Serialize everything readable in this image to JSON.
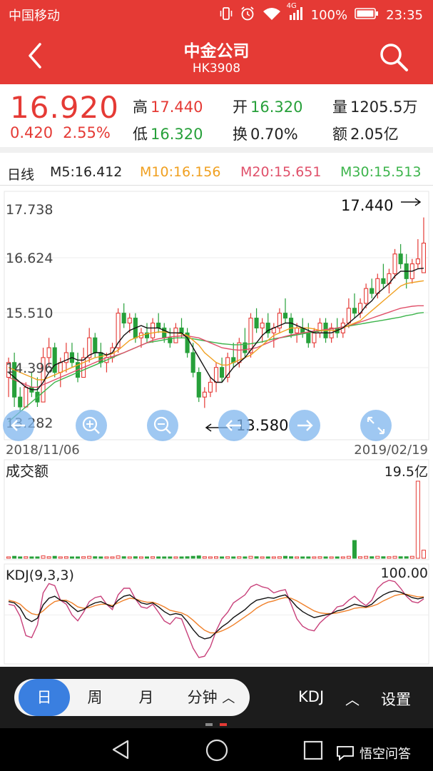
{
  "status_bar": {
    "carrier": "中国移动",
    "network": "4G",
    "battery": "100%",
    "time": "23:35"
  },
  "header": {
    "title": "中金公司",
    "code": "HK3908",
    "back_icon": "chevron-left-icon",
    "search_icon": "search-icon"
  },
  "quote": {
    "price": "16.920",
    "change": "0.420",
    "change_pct": "2.55%",
    "high_label": "高",
    "high": "17.440",
    "low_label": "低",
    "low": "16.320",
    "open_label": "开",
    "open": "16.320",
    "turnover_rate_label": "换",
    "turnover_rate": "0.70%",
    "volume_label": "量",
    "volume": "1205.5万",
    "amount_label": "额",
    "amount": "2.05亿"
  },
  "ma_legend": {
    "period": "日线",
    "m5": "M5:16.412",
    "m10": "M10:16.156",
    "m20": "M20:15.651",
    "m30": "M30:15.513"
  },
  "colors": {
    "up": "#e53a35",
    "down": "#27a03a",
    "m5": "#111111",
    "m10": "#f0a020",
    "m20": "#e0506a",
    "m30": "#3cb44b",
    "k_line": "#111111",
    "d_line": "#f0802a",
    "j_line": "#c8407a",
    "control": "#7fb6ee"
  },
  "chart_data": {
    "type": "candlestick",
    "y_ticks": [
      "17.738",
      "16.624",
      "15.510",
      "14.396",
      "13.282"
    ],
    "ylim": [
      13.282,
      17.738
    ],
    "x_start_label": "2018/11/06",
    "x_end_label": "2019/02/19",
    "max_annotation": "17.440",
    "min_annotation": "13.580",
    "candles": [
      [
        14.2,
        14.6,
        13.8,
        14.5
      ],
      [
        14.5,
        14.7,
        13.6,
        13.8
      ],
      [
        13.8,
        14.0,
        13.5,
        13.6
      ],
      [
        13.6,
        14.1,
        13.58,
        14.0
      ],
      [
        14.0,
        14.3,
        13.8,
        13.9
      ],
      [
        13.9,
        14.2,
        13.6,
        13.7
      ],
      [
        13.7,
        14.8,
        13.7,
        14.6
      ],
      [
        14.6,
        15.0,
        14.4,
        14.8
      ],
      [
        14.8,
        14.9,
        14.2,
        14.3
      ],
      [
        14.3,
        14.6,
        14.0,
        14.5
      ],
      [
        14.5,
        14.9,
        14.3,
        14.7
      ],
      [
        14.7,
        14.9,
        14.4,
        14.5
      ],
      [
        14.5,
        14.7,
        14.1,
        14.2
      ],
      [
        14.2,
        14.8,
        14.2,
        14.6
      ],
      [
        14.6,
        15.2,
        14.5,
        15.0
      ],
      [
        15.0,
        15.1,
        14.6,
        14.7
      ],
      [
        14.7,
        14.9,
        14.4,
        14.5
      ],
      [
        14.5,
        14.7,
        14.3,
        14.6
      ],
      [
        14.6,
        14.9,
        14.5,
        14.8
      ],
      [
        14.8,
        15.6,
        14.7,
        15.5
      ],
      [
        15.5,
        15.7,
        15.2,
        15.3
      ],
      [
        15.3,
        15.5,
        15.1,
        15.4
      ],
      [
        15.4,
        15.5,
        14.9,
        15.0
      ],
      [
        15.0,
        15.2,
        14.8,
        15.1
      ],
      [
        15.1,
        15.3,
        14.9,
        15.0
      ],
      [
        15.0,
        15.4,
        14.9,
        15.3
      ],
      [
        15.3,
        15.5,
        15.1,
        15.2
      ],
      [
        15.2,
        15.3,
        14.9,
        15.0
      ],
      [
        15.0,
        15.2,
        14.8,
        14.9
      ],
      [
        14.9,
        15.3,
        14.9,
        15.2
      ],
      [
        15.2,
        15.4,
        15.0,
        15.1
      ],
      [
        15.1,
        15.2,
        14.6,
        14.7
      ],
      [
        14.7,
        14.9,
        14.2,
        14.3
      ],
      [
        14.3,
        14.4,
        13.7,
        13.8
      ],
      [
        13.8,
        14.0,
        13.58,
        13.9
      ],
      [
        13.9,
        14.2,
        13.8,
        14.1
      ],
      [
        14.1,
        14.5,
        13.9,
        14.4
      ],
      [
        14.4,
        14.6,
        14.1,
        14.2
      ],
      [
        14.2,
        14.7,
        14.1,
        14.6
      ],
      [
        14.6,
        14.9,
        14.4,
        14.5
      ],
      [
        14.5,
        15.0,
        14.4,
        14.9
      ],
      [
        14.9,
        15.2,
        14.6,
        14.7
      ],
      [
        14.7,
        15.5,
        14.6,
        15.4
      ],
      [
        15.4,
        15.6,
        15.1,
        15.2
      ],
      [
        15.2,
        15.4,
        14.9,
        15.3
      ],
      [
        15.3,
        15.5,
        15.0,
        15.1
      ],
      [
        15.1,
        15.3,
        14.8,
        15.2
      ],
      [
        15.2,
        15.6,
        15.1,
        15.5
      ],
      [
        15.5,
        15.8,
        15.3,
        15.4
      ],
      [
        15.4,
        15.5,
        15.0,
        15.1
      ],
      [
        15.1,
        15.3,
        14.9,
        15.2
      ],
      [
        15.2,
        15.4,
        15.0,
        15.1
      ],
      [
        15.1,
        15.3,
        14.8,
        14.9
      ],
      [
        14.9,
        15.2,
        14.8,
        15.1
      ],
      [
        15.1,
        15.4,
        15.0,
        15.3
      ],
      [
        15.3,
        15.4,
        14.9,
        15.0
      ],
      [
        15.0,
        15.3,
        14.9,
        15.2
      ],
      [
        15.2,
        15.4,
        15.0,
        15.1
      ],
      [
        15.1,
        15.4,
        15.0,
        15.3
      ],
      [
        15.3,
        15.8,
        15.2,
        15.6
      ],
      [
        15.6,
        15.9,
        15.4,
        15.5
      ],
      [
        15.5,
        15.8,
        15.4,
        15.7
      ],
      [
        15.7,
        16.1,
        15.6,
        16.0
      ],
      [
        16.0,
        16.2,
        15.8,
        15.9
      ],
      [
        15.9,
        16.3,
        15.8,
        16.2
      ],
      [
        16.2,
        16.5,
        16.0,
        16.1
      ],
      [
        16.1,
        16.4,
        15.9,
        16.3
      ],
      [
        16.3,
        16.8,
        16.2,
        16.7
      ],
      [
        16.7,
        16.9,
        16.4,
        16.5
      ],
      [
        16.5,
        16.7,
        16.0,
        16.2
      ],
      [
        16.2,
        16.6,
        16.1,
        16.5
      ],
      [
        16.5,
        17.0,
        16.4,
        16.6
      ],
      [
        16.32,
        17.44,
        16.32,
        16.92
      ]
    ],
    "ma5": [
      14.3,
      14.2,
      14.1,
      14.0,
      13.95,
      13.95,
      14.1,
      14.3,
      14.45,
      14.5,
      14.55,
      14.6,
      14.55,
      14.55,
      14.65,
      14.7,
      14.7,
      14.65,
      14.7,
      14.9,
      15.05,
      15.15,
      15.2,
      15.25,
      15.2,
      15.2,
      15.2,
      15.15,
      15.1,
      15.1,
      15.1,
      15.0,
      14.8,
      14.6,
      14.4,
      14.2,
      14.1,
      14.1,
      14.25,
      14.4,
      14.5,
      14.6,
      14.75,
      14.9,
      15.05,
      15.15,
      15.2,
      15.25,
      15.3,
      15.3,
      15.25,
      15.2,
      15.15,
      15.1,
      15.1,
      15.1,
      15.1,
      15.15,
      15.2,
      15.3,
      15.4,
      15.5,
      15.65,
      15.75,
      15.9,
      16.0,
      16.1,
      16.25,
      16.35,
      16.35,
      16.35,
      16.4,
      16.412
    ],
    "ma10": [
      14.4,
      14.35,
      14.3,
      14.25,
      14.2,
      14.15,
      14.15,
      14.2,
      14.25,
      14.3,
      14.35,
      14.4,
      14.45,
      14.5,
      14.55,
      14.6,
      14.62,
      14.65,
      14.68,
      14.75,
      14.85,
      14.95,
      15.0,
      15.05,
      15.08,
      15.1,
      15.12,
      15.12,
      15.1,
      15.1,
      15.08,
      15.05,
      14.95,
      14.85,
      14.7,
      14.6,
      14.5,
      14.45,
      14.45,
      14.5,
      14.55,
      14.6,
      14.65,
      14.75,
      14.85,
      14.95,
      15.05,
      15.1,
      15.15,
      15.2,
      15.2,
      15.2,
      15.2,
      15.18,
      15.15,
      15.15,
      15.15,
      15.15,
      15.2,
      15.25,
      15.3,
      15.35,
      15.45,
      15.55,
      15.65,
      15.75,
      15.85,
      15.95,
      16.05,
      16.1,
      16.12,
      16.14,
      16.156
    ],
    "ma20": [
      14.2,
      14.15,
      14.1,
      14.05,
      14.0,
      14.0,
      14.05,
      14.1,
      14.15,
      14.2,
      14.25,
      14.3,
      14.35,
      14.4,
      14.45,
      14.5,
      14.55,
      14.6,
      14.62,
      14.66,
      14.7,
      14.75,
      14.8,
      14.85,
      14.9,
      14.95,
      14.98,
      15.0,
      15.02,
      15.03,
      15.04,
      15.04,
      15.02,
      15.0,
      14.95,
      14.9,
      14.85,
      14.8,
      14.78,
      14.76,
      14.75,
      14.76,
      14.78,
      14.8,
      14.85,
      14.9,
      14.95,
      15.0,
      15.03,
      15.06,
      15.08,
      15.1,
      15.12,
      15.14,
      15.15,
      15.17,
      15.18,
      15.2,
      15.22,
      15.25,
      15.28,
      15.32,
      15.36,
      15.4,
      15.44,
      15.48,
      15.52,
      15.56,
      15.6,
      15.62,
      15.64,
      15.65,
      15.651
    ],
    "ma30": [
      13.3,
      13.4,
      13.5,
      13.6,
      13.7,
      13.8,
      13.9,
      14.0,
      14.1,
      14.15,
      14.2,
      14.25,
      14.3,
      14.35,
      14.4,
      14.45,
      14.5,
      14.55,
      14.6,
      14.65,
      14.7,
      14.75,
      14.8,
      14.85,
      14.9,
      14.92,
      14.94,
      14.96,
      14.98,
      15.0,
      15.0,
      15.0,
      14.98,
      14.96,
      14.94,
      14.92,
      14.9,
      14.88,
      14.87,
      14.86,
      14.86,
      14.87,
      14.88,
      14.9,
      14.92,
      14.95,
      14.98,
      15.0,
      15.02,
      15.04,
      15.06,
      15.08,
      15.1,
      15.12,
      15.14,
      15.16,
      15.18,
      15.2,
      15.22,
      15.24,
      15.26,
      15.28,
      15.3,
      15.32,
      15.34,
      15.36,
      15.38,
      15.4,
      15.42,
      15.45,
      15.47,
      15.5,
      15.513
    ],
    "volume_panel": {
      "label": "成交额",
      "max_label": "19.5亿",
      "values": [
        0.3,
        0.5,
        0.3,
        0.4,
        0.2,
        0.3,
        0.6,
        0.4,
        0.5,
        0.3,
        0.4,
        0.3,
        0.3,
        0.4,
        0.5,
        0.4,
        0.3,
        0.3,
        0.3,
        0.6,
        0.4,
        0.3,
        0.4,
        0.3,
        0.3,
        0.4,
        0.3,
        0.3,
        0.3,
        0.3,
        0.3,
        0.4,
        0.5,
        0.6,
        0.4,
        0.3,
        0.4,
        0.3,
        0.4,
        0.3,
        0.4,
        0.3,
        0.5,
        0.4,
        0.3,
        0.3,
        0.3,
        0.4,
        0.5,
        0.4,
        0.3,
        0.3,
        0.3,
        0.3,
        0.4,
        0.3,
        0.3,
        0.3,
        0.3,
        0.5,
        4.5,
        0.4,
        0.5,
        0.4,
        0.5,
        0.4,
        0.4,
        0.5,
        0.4,
        0.4,
        0.5,
        19.5,
        2.05
      ]
    },
    "kdj_panel": {
      "label": "KDJ(9,3,3)",
      "max_label": "100.00",
      "k": [
        70,
        68,
        60,
        45,
        40,
        45,
        65,
        75,
        78,
        72,
        70,
        62,
        55,
        58,
        64,
        68,
        70,
        66,
        62,
        72,
        78,
        80,
        74,
        68,
        66,
        68,
        62,
        55,
        50,
        52,
        50,
        40,
        28,
        18,
        14,
        16,
        24,
        32,
        38,
        46,
        52,
        58,
        66,
        72,
        74,
        76,
        75,
        78,
        80,
        72,
        62,
        55,
        50,
        46,
        48,
        50,
        52,
        56,
        58,
        62,
        66,
        64,
        62,
        66,
        74,
        80,
        84,
        86,
        84,
        80,
        76,
        74,
        76
      ],
      "d": [
        72,
        70,
        66,
        58,
        52,
        50,
        56,
        64,
        70,
        72,
        72,
        68,
        62,
        60,
        61,
        64,
        66,
        66,
        64,
        68,
        72,
        75,
        74,
        71,
        69,
        69,
        66,
        62,
        57,
        55,
        53,
        49,
        42,
        34,
        27,
        23,
        23,
        26,
        30,
        35,
        41,
        47,
        53,
        60,
        65,
        69,
        71,
        74,
        76,
        75,
        71,
        66,
        61,
        56,
        53,
        52,
        52,
        53,
        55,
        57,
        60,
        61,
        61,
        63,
        66,
        71,
        75,
        79,
        81,
        81,
        79,
        77,
        77
      ],
      "j": [
        66,
        64,
        48,
        19,
        16,
        35,
        83,
        97,
        94,
        72,
        66,
        50,
        41,
        54,
        70,
        76,
        78,
        66,
        58,
        80,
        90,
        90,
        74,
        62,
        60,
        66,
        54,
        41,
        36,
        46,
        44,
        22,
        0,
        -14,
        -12,
        2,
        26,
        44,
        54,
        68,
        74,
        80,
        92,
        96,
        92,
        90,
        83,
        86,
        88,
        66,
        44,
        33,
        28,
        26,
        38,
        46,
        52,
        62,
        64,
        72,
        78,
        70,
        64,
        72,
        90,
        98,
        102,
        100,
        90,
        78,
        70,
        68,
        74
      ]
    }
  },
  "period_bar": {
    "day": "日",
    "week": "周",
    "month": "月",
    "minute": "分钟",
    "indicator": "KDJ",
    "settings": "设置"
  },
  "navbar": {
    "watermark": "悟空问答"
  }
}
